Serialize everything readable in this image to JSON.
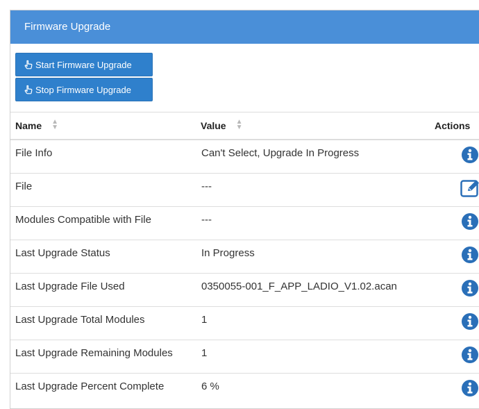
{
  "panel": {
    "title": "Firmware Upgrade"
  },
  "buttons": {
    "start_label": "Start Firmware Upgrade",
    "stop_label": "Stop Firmware Upgrade"
  },
  "table": {
    "headers": {
      "name": "Name",
      "value": "Value",
      "actions": "Actions"
    },
    "rows": [
      {
        "name": "File Info",
        "value": "Can't Select, Upgrade In Progress",
        "action_icon": "info-icon"
      },
      {
        "name": "File",
        "value": "---",
        "action_icon": "edit-icon"
      },
      {
        "name": "Modules Compatible with File",
        "value": "---",
        "action_icon": "info-icon"
      },
      {
        "name": "Last Upgrade Status",
        "value": "In Progress",
        "action_icon": "info-icon"
      },
      {
        "name": "Last Upgrade File Used",
        "value": "0350055-001_F_APP_LADIO_V1.02.acan",
        "action_icon": "info-icon"
      },
      {
        "name": "Last Upgrade Total Modules",
        "value": "1",
        "action_icon": "info-icon"
      },
      {
        "name": "Last Upgrade Remaining Modules",
        "value": "1",
        "action_icon": "info-icon"
      },
      {
        "name": "Last Upgrade Percent Complete",
        "value": "6 %",
        "action_icon": "info-icon"
      }
    ]
  },
  "colors": {
    "header_bg": "#4a8fd8",
    "button_bg": "#2f80cc",
    "icon": "#2a6fb8"
  }
}
